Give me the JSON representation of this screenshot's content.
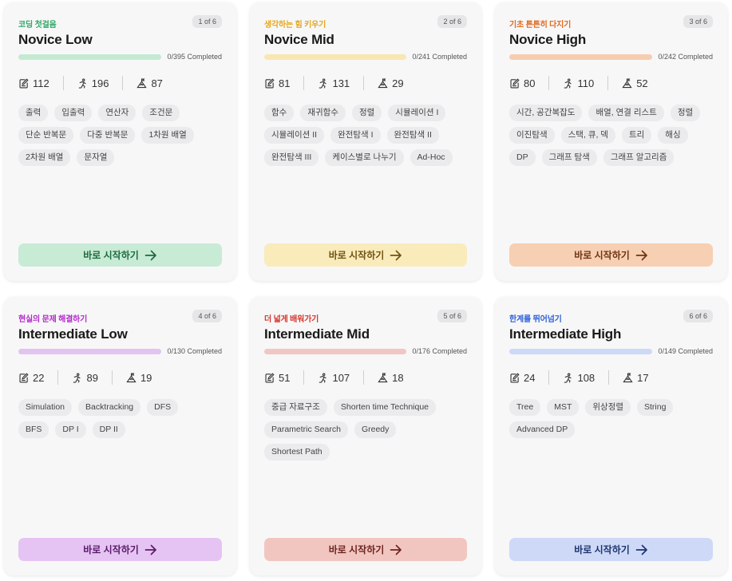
{
  "button_label": "바로 시작하기",
  "cards": [
    {
      "subtitle": "코딩 첫걸음",
      "position": "1 of 6",
      "title": "Novice Low",
      "progress_text": "0/395 Completed",
      "progress": 0,
      "stats": {
        "problems": "112",
        "users": "196",
        "tier": "87"
      },
      "tags": [
        "출력",
        "입출력",
        "연산자",
        "조건문",
        "단순 반복문",
        "다중 반복문",
        "1차원 배열",
        "2차원 배열",
        "문자열"
      ],
      "colors": {
        "accent": "#2ea864",
        "track": "#c4ead3",
        "button": "#c8ebd6",
        "button_text": "#1f6b3f"
      }
    },
    {
      "subtitle": "생각하는 힘 키우기",
      "position": "2 of 6",
      "title": "Novice Mid",
      "progress_text": "0/241 Completed",
      "progress": 0,
      "stats": {
        "problems": "81",
        "users": "131",
        "tier": "29"
      },
      "tags": [
        "함수",
        "재귀함수",
        "정렬",
        "시뮬레이션 I",
        "시뮬레이션 II",
        "완전탐색 I",
        "완전탐색 II",
        "완전탐색 III",
        "케이스별로 나누기",
        "Ad-Hoc"
      ],
      "colors": {
        "accent": "#e5a81c",
        "track": "#f8e7b3",
        "button": "#faebbb",
        "button_text": "#6d5412"
      }
    },
    {
      "subtitle": "기초 튼튼히 다지기",
      "position": "3 of 6",
      "title": "Novice High",
      "progress_text": "0/242 Completed",
      "progress": 0,
      "stats": {
        "problems": "80",
        "users": "110",
        "tier": "52"
      },
      "tags": [
        "시간, 공간복잡도",
        "배열, 연결 리스트",
        "정렬",
        "이진탐색",
        "스택, 큐, 덱",
        "트리",
        "해싱",
        "DP",
        "그래프 탐색",
        "그래프 알고리즘"
      ],
      "colors": {
        "accent": "#e06a1e",
        "track": "#f6cdb0",
        "button": "#f7cfb2",
        "button_text": "#6e3514"
      }
    },
    {
      "subtitle": "현실의 문제 해결하기",
      "position": "4 of 6",
      "title": "Intermediate Low",
      "progress_text": "0/130 Completed",
      "progress": 0,
      "stats": {
        "problems": "22",
        "users": "89",
        "tier": "19"
      },
      "tags": [
        "Simulation",
        "Backtracking",
        "DFS",
        "BFS",
        "DP I",
        "DP II"
      ],
      "colors": {
        "accent": "#b42bc9",
        "track": "#e3c3f0",
        "button": "#e5c3f3",
        "button_text": "#5a1b69"
      }
    },
    {
      "subtitle": "더 넓게 배워가기",
      "position": "5 of 6",
      "title": "Intermediate Mid",
      "progress_text": "0/176 Completed",
      "progress": 0,
      "stats": {
        "problems": "51",
        "users": "107",
        "tier": "18"
      },
      "tags": [
        "중급 자료구조",
        "Shorten time Technique",
        "Parametric Search",
        "Greedy",
        "Shortest Path"
      ],
      "colors": {
        "accent": "#d4362c",
        "track": "#f2c6c1",
        "button": "#f2c6c0",
        "button_text": "#6e2420"
      }
    },
    {
      "subtitle": "한계를 뛰어넘기",
      "position": "6 of 6",
      "title": "Intermediate High",
      "progress_text": "0/149 Completed",
      "progress": 0,
      "stats": {
        "problems": "24",
        "users": "108",
        "tier": "17"
      },
      "tags": [
        "Tree",
        "MST",
        "위상정렬",
        "String",
        "Advanced DP"
      ],
      "colors": {
        "accent": "#2f5fd6",
        "track": "#cdd9f7",
        "button": "#ced9f8",
        "button_text": "#1f3570"
      }
    }
  ]
}
